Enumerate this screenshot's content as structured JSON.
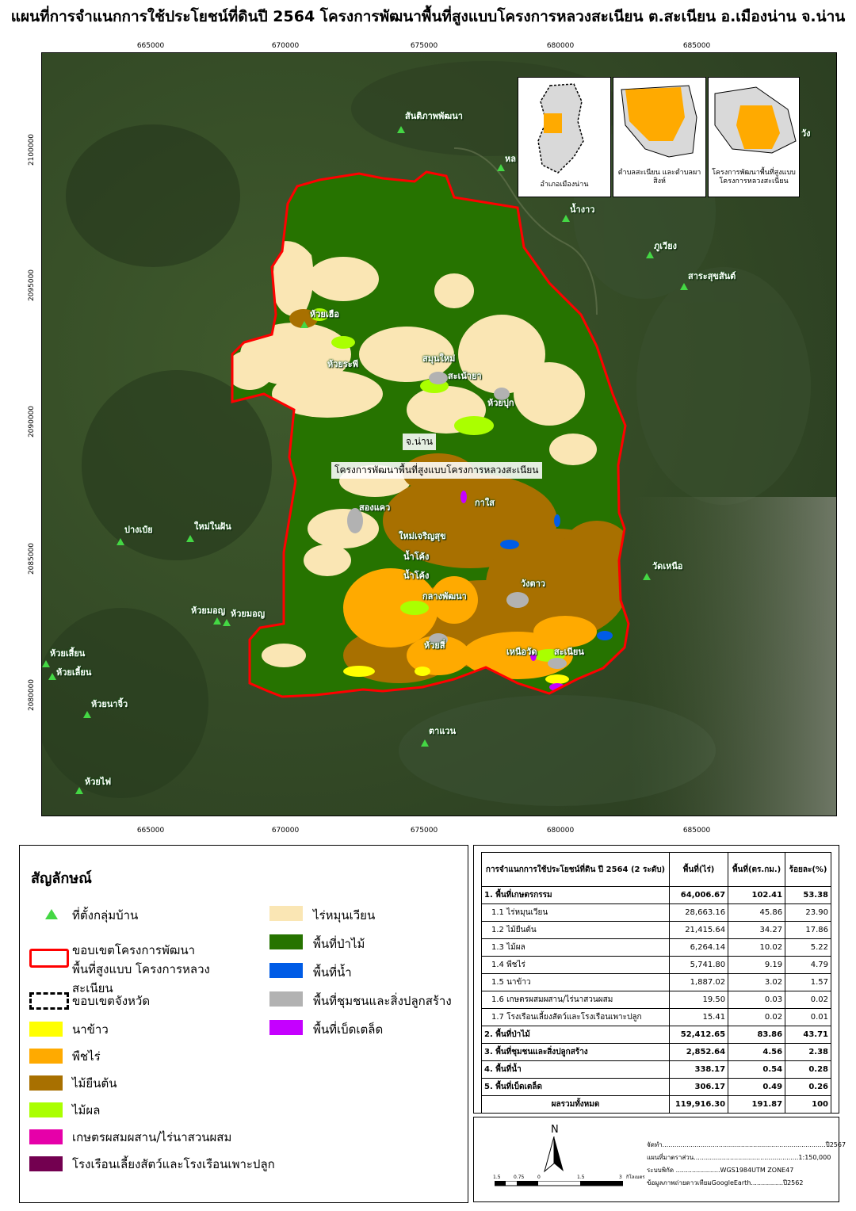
{
  "title": "แผนที่การจำแนกการใช้ประโยชน์ที่ดินปี 2564 โครงการพัฒนาพื้นที่สูงแบบโครงการหลวงสะเนียน ต.สะเนียน อ.เมืองน่าน จ.น่าน",
  "map": {
    "x_ticks": [
      "665000",
      "670000",
      "675000",
      "680000",
      "685000"
    ],
    "y_ticks": [
      "2100000",
      "2095000",
      "2090000",
      "2085000",
      "2080000"
    ],
    "center_labels": [
      "จ.น่าน",
      "โครงการพัฒนาพื้นที่สูงแบบโครงการหลวงสะเนียน"
    ],
    "villages": [
      "สันติภาพพัฒนา",
      "หล",
      "น้ำงาว",
      "ภูเวียง",
      "สาระสุขสันต์",
      "ห้วยเฮือ",
      "ห้วยระพี",
      "สมุนใหม่",
      "สะเน้ายา",
      "ห้วยปุก",
      "สองแคว",
      "กาใส",
      "ปางเป๋ย",
      "ใหม่ในฝัน",
      "ใหม่เจริญสุข",
      "น้ำโค้ง",
      "น้ำโค้ง",
      "กลางพัฒนา",
      "วังตาว",
      "วัดเหนือ",
      "ห้วยมอญ",
      "ห้วยมอญ",
      "ห้วยสี่",
      "เหนือวัด",
      "สะเนียน",
      "ห้วยเสี้ยน",
      "ห้วยเลี้ยน",
      "ห้วยนาจิ้ว",
      "ตาแวน",
      "ห้วยไฟ",
      "วัง"
    ],
    "insets": [
      {
        "caption": "อำเภอเมืองน่าน"
      },
      {
        "caption": "ตำบลสะเนียน และตำบลผาสิงห์"
      },
      {
        "caption": "โครงการพัฒนาพื้นที่สูงแบบ โครงการหลวงสะเนียน"
      }
    ]
  },
  "legend": {
    "title": "สัญลักษณ์",
    "left_items": [
      {
        "label": "ที่ตั้งกลุ่มบ้าน",
        "type": "village"
      },
      {
        "label": "ขอบเขตโครงการพัฒนาพื้นที่สูงแบบ โครงการหลวงสะเนียน",
        "type": "project-boundary"
      },
      {
        "label": "ขอบเขตจังหวัด",
        "type": "province-boundary"
      },
      {
        "label": "นาข้าว",
        "color": "#ffff00"
      },
      {
        "label": "พืชไร่",
        "color": "#ffaa00"
      },
      {
        "label": "ไม้ยืนต้น",
        "color": "#a87000"
      },
      {
        "label": "ไม้ผล",
        "color": "#aaff00"
      },
      {
        "label": "เกษตรผสมผสาน/ไร่นาสวนผสม",
        "color": "#e600a9"
      },
      {
        "label": "โรงเรือนเลี้ยงสัตว์และโรงเรือนเพาะปลูก",
        "color": "#730050"
      }
    ],
    "right_items": [
      {
        "label": "ไร่หมุนเวียน",
        "color": "#fae6b4"
      },
      {
        "label": "พื้นที่ป่าไม้",
        "color": "#267300"
      },
      {
        "label": "พื้นที่น้ำ",
        "color": "#005ce6"
      },
      {
        "label": "พื้นที่ชุมชนและสิ่งปลูกสร้าง",
        "color": "#b2b2b2"
      },
      {
        "label": "พื้นที่เบ็ดเตล็ด",
        "color": "#c500ff"
      }
    ]
  },
  "table": {
    "headers": [
      "การจำแนกการใช้ประโยชน์ที่ดิน ปี 2564 (2 ระดับ)",
      "พื้นที่(ไร่)",
      "พื้นที่(ตร.กม.)",
      "ร้อยละ(%)"
    ],
    "rows": [
      {
        "label": "1. พื้นที่เกษตรกรรม",
        "rai": "64,006.67",
        "sqkm": "102.41",
        "pct": "53.38",
        "level": "main"
      },
      {
        "label": "1.1 ไร่หมุนเวียน",
        "rai": "28,663.16",
        "sqkm": "45.86",
        "pct": "23.90",
        "level": "sub"
      },
      {
        "label": "1.2 ไม้ยืนต้น",
        "rai": "21,415.64",
        "sqkm": "34.27",
        "pct": "17.86",
        "level": "sub"
      },
      {
        "label": "1.3 ไม้ผล",
        "rai": "6,264.14",
        "sqkm": "10.02",
        "pct": "5.22",
        "level": "sub"
      },
      {
        "label": "1.4 พืชไร่",
        "rai": "5,741.80",
        "sqkm": "9.19",
        "pct": "4.79",
        "level": "sub"
      },
      {
        "label": "1.5 นาข้าว",
        "rai": "1,887.02",
        "sqkm": "3.02",
        "pct": "1.57",
        "level": "sub"
      },
      {
        "label": "1.6 เกษตรผสมผสาน/ไร่นาสวนผสม",
        "rai": "19.50",
        "sqkm": "0.03",
        "pct": "0.02",
        "level": "sub"
      },
      {
        "label": "1.7 โรงเรือนเลี้ยงสัตว์และโรงเรือนเพาะปลูก",
        "rai": "15.41",
        "sqkm": "0.02",
        "pct": "0.01",
        "level": "sub"
      },
      {
        "label": "2. พื้นที่ป่าไม้",
        "rai": "52,412.65",
        "sqkm": "83.86",
        "pct": "43.71",
        "level": "main"
      },
      {
        "label": "3. พื้นที่ชุมชนและสิ่งปลูกสร้าง",
        "rai": "2,852.64",
        "sqkm": "4.56",
        "pct": "2.38",
        "level": "main"
      },
      {
        "label": "4. พื้นที่น้ำ",
        "rai": "338.17",
        "sqkm": "0.54",
        "pct": "0.28",
        "level": "main"
      },
      {
        "label": "5. พื้นที่เบ็ดเตล็ด",
        "rai": "306.17",
        "sqkm": "0.49",
        "pct": "0.26",
        "level": "main"
      }
    ],
    "total": {
      "label": "ผลรวมทั้งหมด",
      "rai": "119,916.30",
      "sqkm": "191.87",
      "pct": "100"
    }
  },
  "info": {
    "north": "N",
    "scale_ticks": [
      "1.5",
      "0.75",
      "0",
      "1.5",
      "3"
    ],
    "scale_unit": "กิโลเมตร",
    "lines": [
      "จัดทำ.................................................................................ปี2567",
      "แผนที่มาตราส่วน....................................................1:150,000",
      "ระบบพิกัด ......................WGS1984UTM ZONE47",
      "ข้อมูลภาพถ่ายดาวเทียมGoogleEarth................ปี2562"
    ]
  }
}
